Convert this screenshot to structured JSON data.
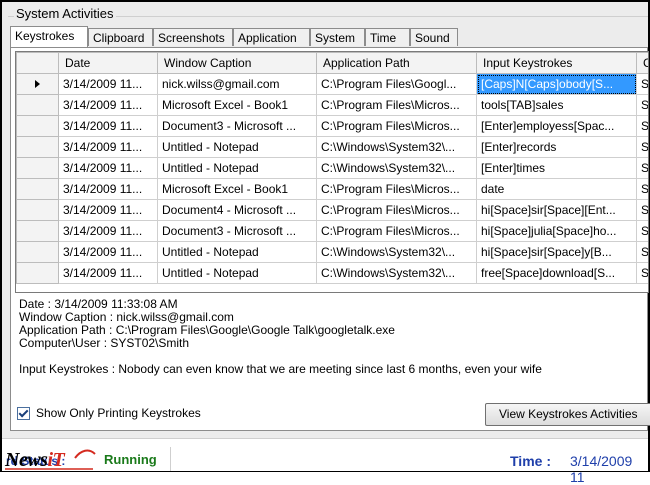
{
  "group_title": "System Activities",
  "tabs": [
    {
      "label": "Keystrokes",
      "active": true
    },
    {
      "label": "Clipboard"
    },
    {
      "label": "Screenshots"
    },
    {
      "label": "Application"
    },
    {
      "label": "System"
    },
    {
      "label": "Time"
    },
    {
      "label": "Sound"
    }
  ],
  "grid": {
    "columns": [
      "Date",
      "Window Caption",
      "Application Path",
      "Input Keystrokes",
      "C"
    ],
    "rows": [
      [
        "3/14/2009 11...",
        "nick.wilss@gmail.com",
        "C:\\Program Files\\Googl...",
        "[Caps]N[Caps]obody[S...",
        "SY"
      ],
      [
        "3/14/2009 11...",
        "Microsoft Excel - Book1",
        "C:\\Program Files\\Micros...",
        "tools[TAB]sales",
        "SY"
      ],
      [
        "3/14/2009 11...",
        "Document3 - Microsoft ...",
        "C:\\Program Files\\Micros...",
        "[Enter]employess[Spac...",
        "SY"
      ],
      [
        "3/14/2009 11...",
        "Untitled - Notepad",
        "C:\\Windows\\System32\\...",
        "[Enter]records",
        "SY"
      ],
      [
        "3/14/2009 11...",
        "Untitled - Notepad",
        "C:\\Windows\\System32\\...",
        "[Enter]times",
        "SY"
      ],
      [
        "3/14/2009 11...",
        "Microsoft Excel - Book1",
        "C:\\Program Files\\Micros...",
        "date",
        "SY"
      ],
      [
        "3/14/2009 11...",
        "Document4 - Microsoft ...",
        "C:\\Program Files\\Micros...",
        "hi[Space]sir[Space][Ent...",
        "SY"
      ],
      [
        "3/14/2009 11...",
        "Document3 - Microsoft ...",
        "C:\\Program Files\\Micros...",
        "hi[Space]julia[Space]ho...",
        "SY"
      ],
      [
        "3/14/2009 11...",
        "Untitled - Notepad",
        "C:\\Windows\\System32\\...",
        "hi[Space]sir[Space]y[B...",
        "SY"
      ],
      [
        "3/14/2009 11...",
        "Untitled - Notepad",
        "C:\\Windows\\System32\\...",
        "free[Space]download[S...",
        "SY"
      ]
    ]
  },
  "details": {
    "date": "Date : 3/14/2009 11:33:08 AM",
    "caption": "Window Caption : nick.wilss@gmail.com",
    "path": "Application Path : C:\\Program Files\\Google\\Google Talk\\googletalk.exe",
    "user": "Computer\\User : SYST02\\Smith",
    "keystrokes": "Input Keystrokes : Nobody can even know that we are meeting since last 6 months, even your wife"
  },
  "checkbox": {
    "label": "Show Only Printing Keystrokes",
    "checked": true
  },
  "button_label": "View Keystrokes Activities",
  "status": {
    "label": "rd Status :",
    "value": "Running",
    "time_label": "Time :",
    "time_value": "3/14/2009  11"
  },
  "logo": {
    "text": "News",
    "accent": "iT"
  }
}
